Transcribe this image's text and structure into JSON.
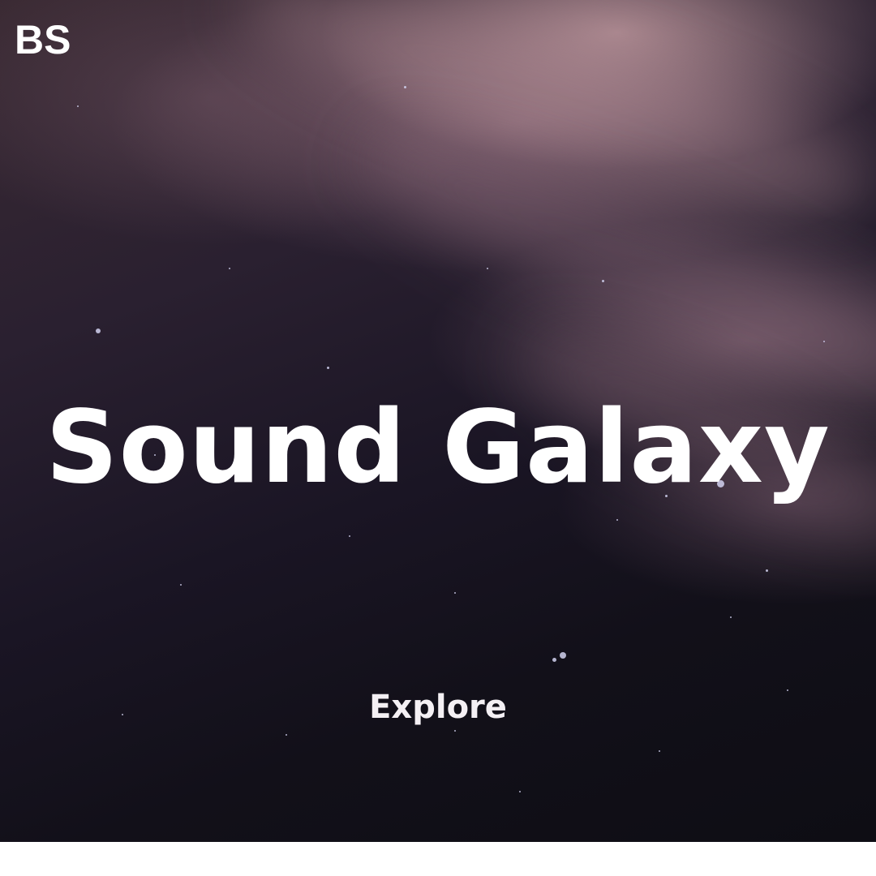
{
  "brand": {
    "logo_text": "BS"
  },
  "hero": {
    "title": "Sound Galaxy",
    "cta_label": "Explore",
    "background": "starry night sky with pink nebula haze",
    "colors": {
      "haze": "#c8a0a5",
      "sky_dark": "#0e0d14",
      "text": "#ffffff"
    }
  }
}
